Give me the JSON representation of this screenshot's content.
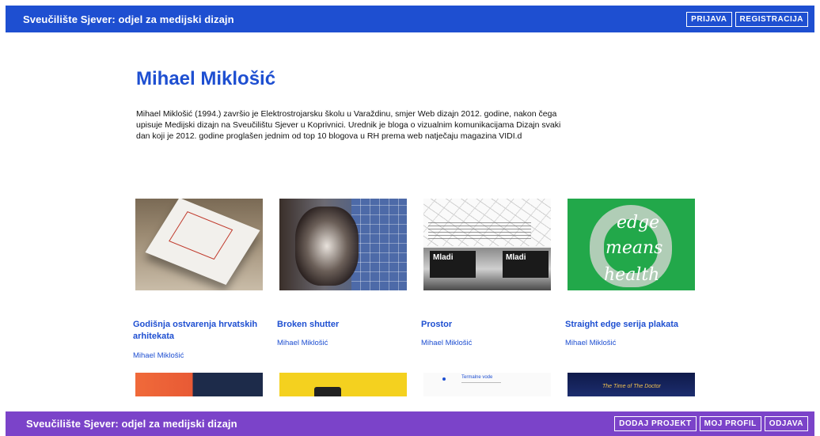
{
  "header": {
    "title": "Sveučilište Sjever: odjel za medijski dizajn",
    "buttons": {
      "login": "PRIJAVA",
      "register": "REGISTRACIJA"
    }
  },
  "profile": {
    "name": "Mihael Miklošić",
    "bio": "Mihael Miklošić (1994.) završio je Elektrostrojarsku školu u Varaždinu, smjer Web dizajn 2012. godine, nakon čega upisuje Medijski dizajn na Sveučilištu Sjever u Koprivnici. Urednik je bloga o vizualnim komunikacijama Dizajn svaki dan koji je 2012. godine proglašen jednim od top 10 blogova u RH prema web natječaju magazina VIDI.d"
  },
  "projects": [
    {
      "title": "Godišnja ostvarenja hrvatskih arhitekata",
      "author": "Mihael Miklošić"
    },
    {
      "title": "Broken shutter",
      "author": "Mihael Miklošić"
    },
    {
      "title": "Prostor",
      "author": "Mihael Miklošić",
      "thumb_text": [
        "Mladi",
        "Mladi"
      ]
    },
    {
      "title": "Straight edge serija plakata",
      "author": "Mihael Miklošić",
      "thumb_text": [
        "edge",
        "means",
        "health"
      ]
    }
  ],
  "partial_thumbs": {
    "t7_label": "Termalne vode",
    "t8_label": "The Time of The Doctor"
  },
  "footer": {
    "title": "Sveučilište Sjever: odjel za medijski dizajn",
    "buttons": {
      "add_project": "DODAJ PROJEKT",
      "my_profile": "MOJ PROFIL",
      "logout": "ODJAVA"
    }
  },
  "colors": {
    "primary": "#1e4fd1",
    "footer": "#7b43c9"
  }
}
